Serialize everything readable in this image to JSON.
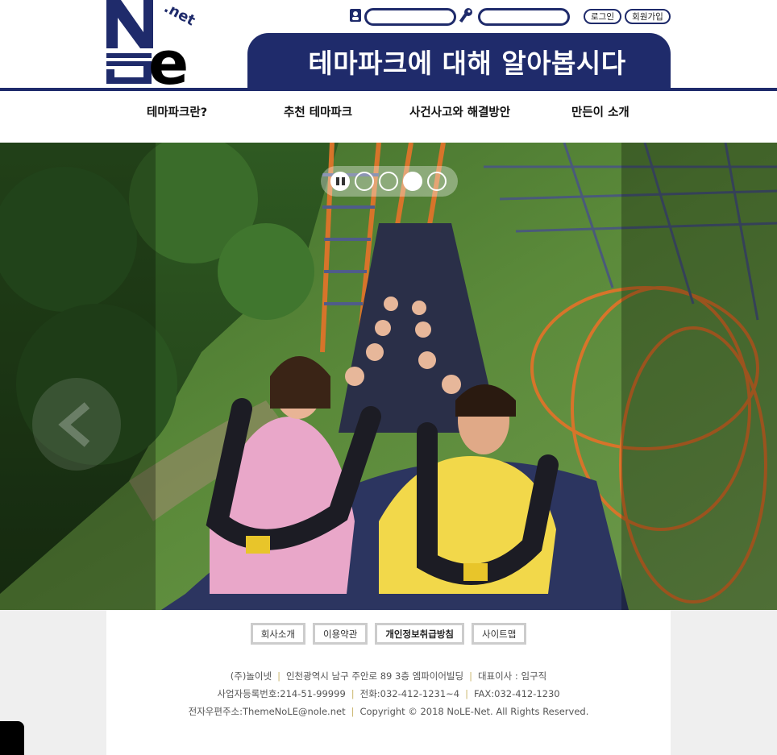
{
  "header": {
    "logo_text_top": ".net",
    "logo_letters": "N e",
    "logo_hangul": "놀",
    "id_placeholder": "",
    "pw_placeholder": "",
    "login_label": "로그인",
    "join_label": "회원가입",
    "banner_title": "테마파크에 대해 알아봅시다"
  },
  "nav": {
    "items": [
      {
        "label": "테마파크란?"
      },
      {
        "label": "추천 테마파크"
      },
      {
        "label": "사건사고와 해결방안"
      },
      {
        "label": "만든이 소개"
      }
    ]
  },
  "slider": {
    "slide_count": 4,
    "active_index": 2,
    "image_subject": "roller-coaster-riders"
  },
  "footer": {
    "links": [
      {
        "label": "회사소개",
        "bold": false
      },
      {
        "label": "이용약관",
        "bold": false
      },
      {
        "label": "개인정보취급방침",
        "bold": true
      },
      {
        "label": "사이트맵",
        "bold": false
      }
    ],
    "company": "(주)놀이넷",
    "address": "인천광역시 남구 주안로 89 3층 엠파이어빌딩",
    "ceo": "대표이사 : 임구직",
    "biz_no": "사업자등록번호:214-51-99999",
    "phone": "전화:032-412-1231~4",
    "fax": "FAX:032-412-1230",
    "email": "전자우편주소:ThemeNoLE@nole.net",
    "copyright": "Copyright © 2018 NoLE-Net. All Rights Reserved."
  },
  "colors": {
    "brand_navy": "#1f2b6b",
    "footer_bg": "#efefef",
    "separator": "#c9b56a"
  }
}
